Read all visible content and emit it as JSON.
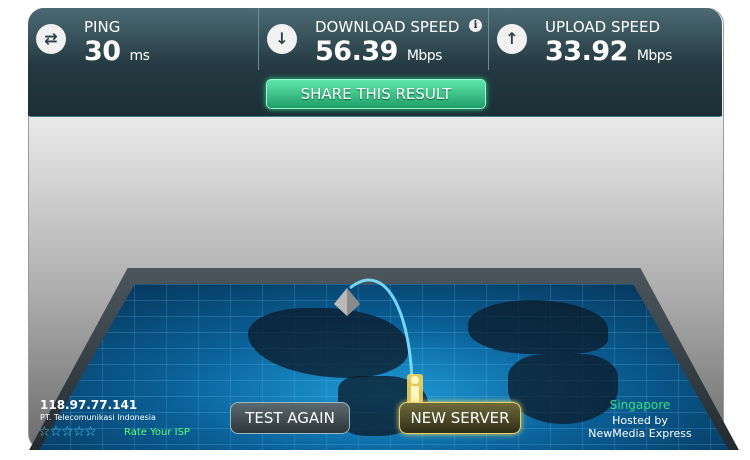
{
  "stats": {
    "ping": {
      "label": "PING",
      "value": "30",
      "unit": "ms",
      "icon": "ping-icon"
    },
    "download": {
      "label": "DOWNLOAD SPEED",
      "value": "56.39",
      "unit": "Mbps",
      "icon": "download-arrow-icon"
    },
    "upload": {
      "label": "UPLOAD SPEED",
      "value": "33.92",
      "unit": "Mbps",
      "icon": "upload-arrow-icon"
    }
  },
  "share_button": "SHARE THIS RESULT",
  "client": {
    "ip": "118.97.77.141",
    "isp": "PT. Telecomunikasi Indonesia",
    "rate_label": "Rate Your ISP",
    "stars": 0
  },
  "buttons": {
    "test_again": "TEST AGAIN",
    "new_server": "NEW SERVER"
  },
  "server": {
    "city": "Singapore",
    "hosted_by": "Hosted by",
    "host": "NewMedia Express"
  },
  "colors": {
    "share_green": "#1f9e68",
    "map_blue": "#1e9bd8",
    "accent_gold": "#e8d36a",
    "rate_green": "#5cff6e"
  }
}
